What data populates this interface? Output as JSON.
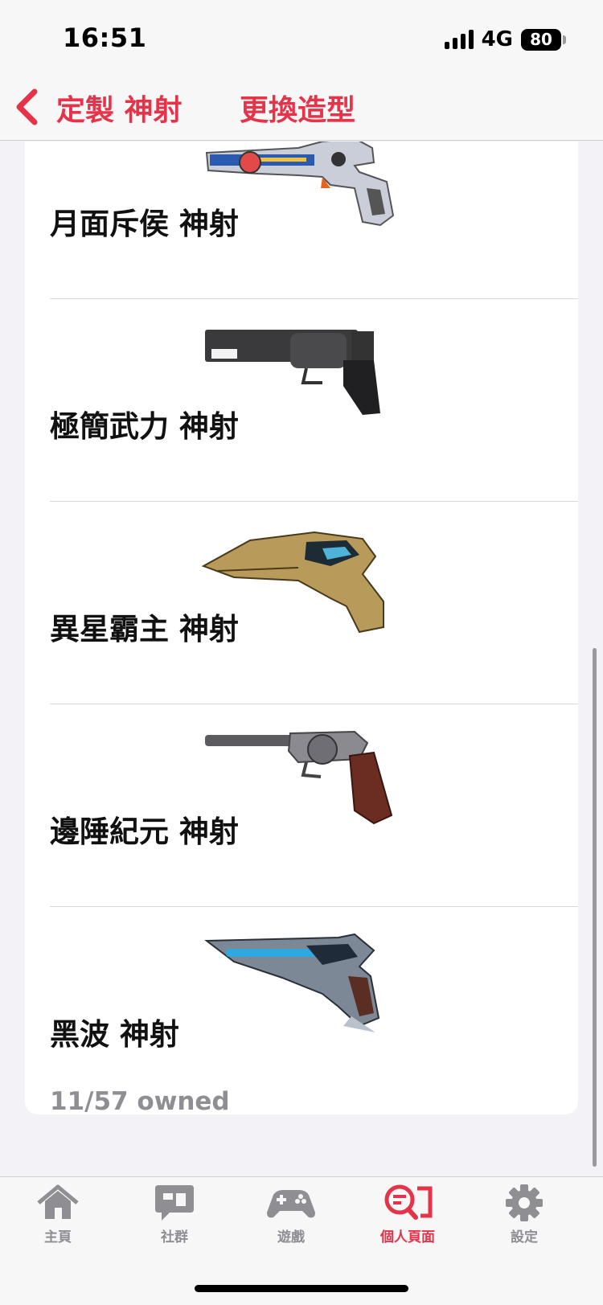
{
  "status_bar": {
    "time": "16:51",
    "network": "4G",
    "battery": "80"
  },
  "nav": {
    "back_label": "定製 神射",
    "title": "更換造型"
  },
  "skins": [
    {
      "name": "月面斥侯 神射",
      "gun_icon": "spectre-space-revolver-icon"
    },
    {
      "name": "極簡武力 神射",
      "gun_icon": "minimal-black-revolver-icon"
    },
    {
      "name": "異星霸主 神射",
      "gun_icon": "gold-alien-revolver-icon"
    },
    {
      "name": "邊陲紀元 神射",
      "gun_icon": "classic-steel-revolver-icon"
    },
    {
      "name": "黑波 神射",
      "gun_icon": "blue-energy-revolver-icon"
    }
  ],
  "owned_count": "11/57 owned",
  "tabs": [
    {
      "label": "主頁",
      "icon": "home-icon",
      "active": false
    },
    {
      "label": "社群",
      "icon": "chat-icon",
      "active": false
    },
    {
      "label": "遊戲",
      "icon": "gamepad-icon",
      "active": false
    },
    {
      "label": "個人頁面",
      "icon": "profile-search-icon",
      "active": true
    },
    {
      "label": "設定",
      "icon": "gear-icon",
      "active": false
    }
  ],
  "colors": {
    "accent": "#e5344a",
    "inactive": "#8e8e93",
    "background": "#f2f2f7"
  }
}
